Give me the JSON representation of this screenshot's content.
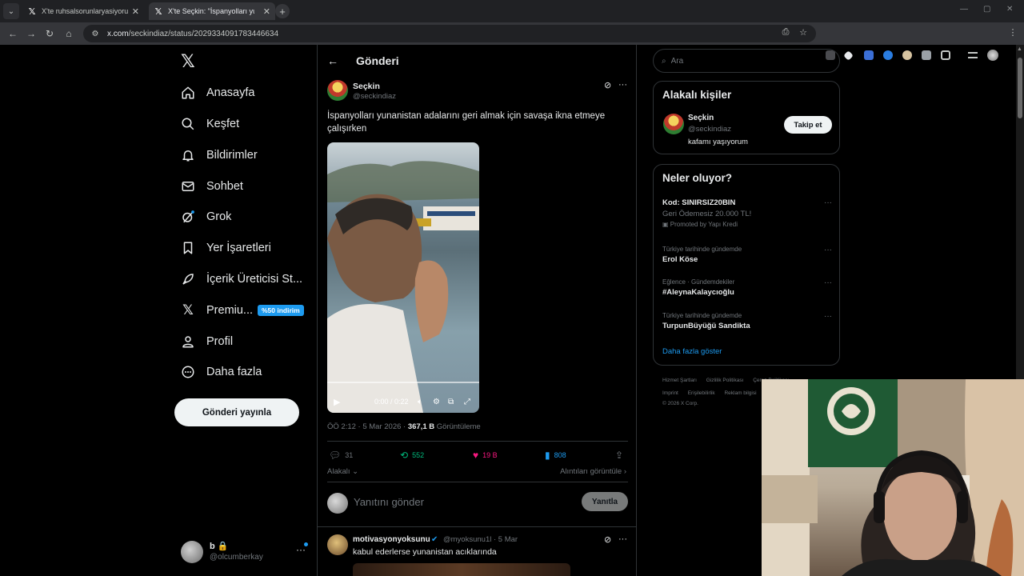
{
  "browser": {
    "tabs": [
      {
        "title": "X'te ruhsalsorunlaryasiyorum: \"...",
        "active": false
      },
      {
        "title": "X'te Seçkin: \"İspanyolları yunan...",
        "active": true
      }
    ],
    "url_domain": "x.com",
    "url_path": "/seckindiaz/status/2029334091783446634"
  },
  "sidebar": {
    "items": [
      {
        "label": "Anasayfa",
        "icon": "home-icon"
      },
      {
        "label": "Keşfet",
        "icon": "search-icon"
      },
      {
        "label": "Bildirimler",
        "icon": "bell-icon"
      },
      {
        "label": "Sohbet",
        "icon": "mail-icon"
      },
      {
        "label": "Grok",
        "icon": "grok-icon"
      },
      {
        "label": "Yer İşaretleri",
        "icon": "bookmark-icon"
      },
      {
        "label": "İçerik Üreticisi St...",
        "icon": "rocket-icon"
      },
      {
        "label": "Premiu...",
        "icon": "x-logo-icon"
      },
      {
        "label": "Profil",
        "icon": "person-icon"
      },
      {
        "label": "Daha fazla",
        "icon": "more-circle-icon"
      }
    ],
    "premium_badge": "%50 indirim",
    "post_button": "Gönderi yayınla",
    "account": {
      "name": "b 🔒",
      "handle": "@olcumberkay"
    }
  },
  "post": {
    "header_title": "Gönderi",
    "author_name": "Seçkin",
    "author_handle": "@seckindiaz",
    "text": "İspanyolları yunanistan adalarını geri almak için savaşa ikna etmeye çalışırken",
    "video_time": "0:00 / 0:22",
    "video_progress": 0,
    "meta_time": "ÖÖ 2:12 · 5 Mar 2026 · ",
    "views": "367,1 B",
    "views_label": " Görüntüleme",
    "stats": {
      "replies": "31",
      "reposts": "552",
      "likes": "19 B",
      "bookmarks": "808"
    },
    "related_label": "Alakalı",
    "quotes_label": "Alıntıları görüntüle ›",
    "reply_placeholder": "Yanıtını gönder",
    "reply_button": "Yanıtla"
  },
  "reply": {
    "name": "motivasyonyoksunu",
    "handle_time": "@myoksunu1l · 5 Mar",
    "text": "kabul ederlerse yunanistan acıklarında"
  },
  "right": {
    "search_placeholder": "Ara",
    "relevant": {
      "title": "Alakalı kişiler",
      "name": "Seçkin",
      "handle": "@seckindiaz",
      "bio": "kafamı yaşıyorum",
      "follow": "Takip et"
    },
    "trends": {
      "title": "Neler oluyor?",
      "items": [
        {
          "context": "",
          "name": "Kod: SINIRSIZ20BIN",
          "sub": "Geri Ödemesiz 20.000 TL!",
          "promo": "Promoted by Yapı Kredi"
        },
        {
          "context": "Türkiye tarihinde gündemde",
          "name": "Erol Köse"
        },
        {
          "context": "Eğlence · Gündemdekiler",
          "name": "#AleynaKalaycıoğlu"
        },
        {
          "context": "Türkiye tarihinde gündemde",
          "name": "TurpunBüyüğü Sandikta"
        }
      ],
      "show_more": "Daha fazla göster"
    },
    "footer": {
      "line1": [
        "Hizmet Şartları",
        "Gizlilik Politikası",
        "Çerez Politikası"
      ],
      "line2": [
        "Imprint",
        "Erişilebilirlik",
        "Reklam bilgisi"
      ],
      "line3": "© 2026 X Corp."
    }
  },
  "colors": {
    "accent": "#1d9bf0",
    "like": "#f91880",
    "repost": "#00ba7c",
    "background": "#000000",
    "border": "#2f3336"
  }
}
